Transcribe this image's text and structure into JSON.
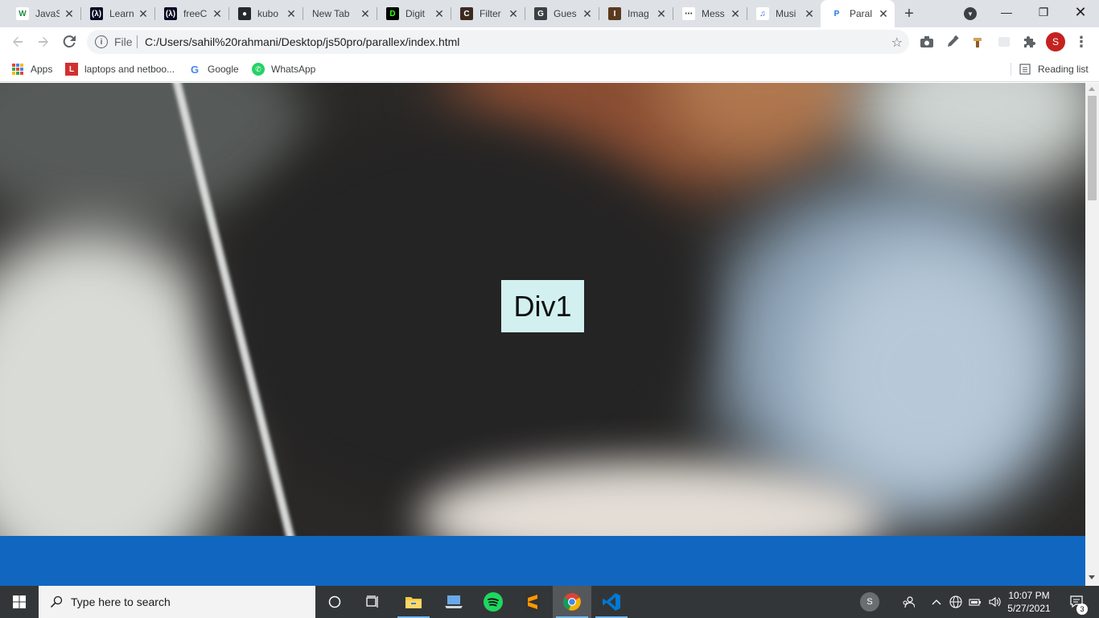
{
  "browser": {
    "tabs": [
      {
        "title": "JavaScript",
        "favicon": "w-icon",
        "fav_bg": "#ffffff",
        "fav_fg": "#1e8e3e",
        "fav_text": "W"
      },
      {
        "title": "Learn",
        "favicon": "code-icon",
        "fav_bg": "#0a0a23",
        "fav_fg": "#ffffff",
        "fav_text": "(λ)"
      },
      {
        "title": "freeCodeCamp",
        "favicon": "code-icon",
        "fav_bg": "#0a0a23",
        "fav_fg": "#ffffff",
        "fav_text": "(λ)"
      },
      {
        "title": "kubo",
        "favicon": "github-icon",
        "fav_bg": "#24292e",
        "fav_fg": "#ffffff",
        "fav_text": "●"
      },
      {
        "title": "New Tab",
        "favicon": "",
        "fav_bg": "transparent",
        "fav_fg": "#3c4043",
        "fav_text": ""
      },
      {
        "title": "Digital",
        "favicon": "digital-icon",
        "fav_bg": "#000000",
        "fav_fg": "#39ff14",
        "fav_text": "D"
      },
      {
        "title": "Filter",
        "favicon": "c-icon",
        "fav_bg": "#3b2a20",
        "fav_fg": "#ffffff",
        "fav_text": "C"
      },
      {
        "title": "Guess",
        "favicon": "g-icon",
        "fav_bg": "#3c4043",
        "fav_fg": "#ffffff",
        "fav_text": "G"
      },
      {
        "title": "Image",
        "favicon": "i-icon",
        "fav_bg": "#5a3a1e",
        "fav_fg": "#ffffff",
        "fav_text": "I"
      },
      {
        "title": "Messages",
        "favicon": "message-icon",
        "fav_bg": "#ffffff",
        "fav_fg": "#3c4043",
        "fav_text": "⋯"
      },
      {
        "title": "Music",
        "favicon": "music-icon",
        "fav_bg": "#ffffff",
        "fav_fg": "#3367d6",
        "fav_text": "♫"
      },
      {
        "title": "Parallax",
        "favicon": "p-icon",
        "fav_bg": "#ffffff",
        "fav_fg": "#1a73e8",
        "fav_text": "P",
        "active": true
      }
    ],
    "tab_titles_display": [
      "JavaS",
      "Learn",
      "freeC",
      "kubo",
      "New Tab",
      "Digit",
      "Filter",
      "Gues",
      "Imag",
      "Mess",
      "Musi",
      "Paral"
    ],
    "address": {
      "scheme_label": "File",
      "url": "C:/Users/sahil%20rahmani/Desktop/js50pro/parallex/index.html"
    },
    "profile_initial": "S",
    "profile_color": "#c5221f",
    "bookmarks": [
      {
        "label": "Apps",
        "icon": "apps-grid-icon"
      },
      {
        "label": "laptops and netboo...",
        "icon": "l-icon"
      },
      {
        "label": "Google",
        "icon": "google-icon"
      },
      {
        "label": "WhatsApp",
        "icon": "whatsapp-icon"
      }
    ],
    "reading_list_label": "Reading list"
  },
  "page": {
    "div1_label": "Div1",
    "div1_bg": "#d2f0f0",
    "band_color": "#1167c0"
  },
  "taskbar": {
    "search_placeholder": "Type here to search",
    "tray_avatar": "S",
    "notification_count": "3",
    "time": "10:07 PM",
    "date": "5/27/2021"
  }
}
